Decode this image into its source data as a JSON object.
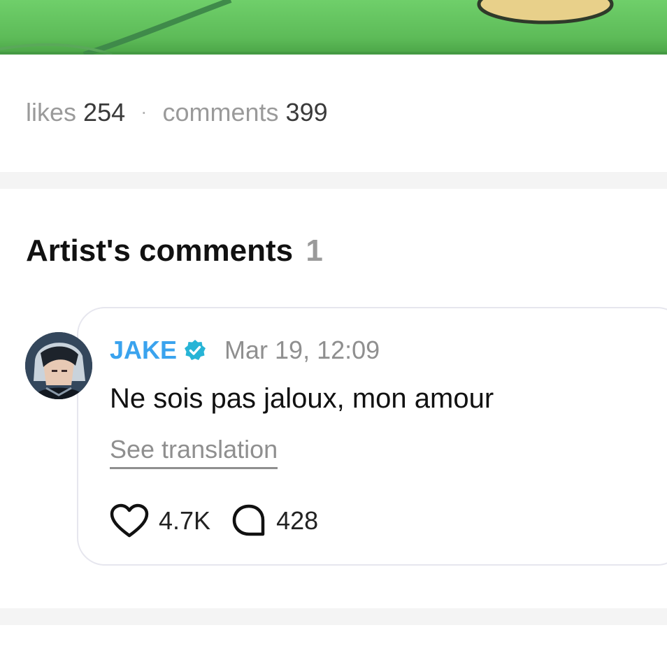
{
  "stats": {
    "likes_label": "likes",
    "likes_value": "254",
    "separator": "·",
    "comments_label": "comments",
    "comments_value": "399"
  },
  "artist_comments": {
    "title": "Artist's comments",
    "count": "1"
  },
  "comment": {
    "author": "JAKE",
    "timestamp": "Mar 19, 12:09",
    "text": "Ne sois pas jaloux, mon amour",
    "translate_label": "See translation",
    "likes": "4.7K",
    "replies": "428"
  },
  "colors": {
    "author": "#3aa3ee",
    "verified_badge": "#27b4d6",
    "muted_text": "#8f8f8f",
    "divider": "#f4f4f4",
    "card_border": "#e6e6ee"
  },
  "icons": {
    "verified": "verified-badge-icon",
    "like": "heart-outline-icon",
    "reply": "chat-bubble-outline-icon"
  }
}
